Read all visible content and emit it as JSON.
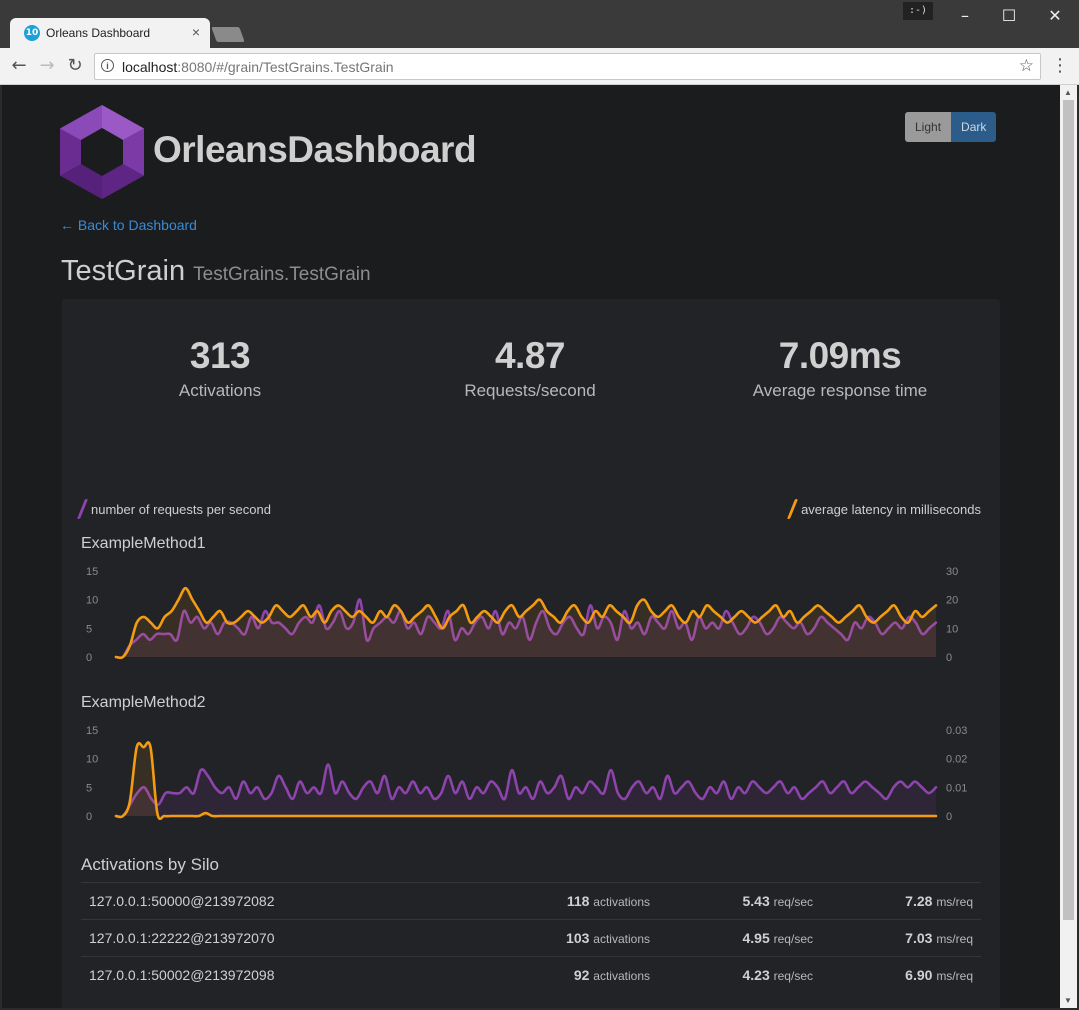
{
  "browser": {
    "tab_title": "Orleans Dashboard",
    "tab_icon": "10",
    "tab_close": "×",
    "badge": ":-)",
    "url_host": "localhost",
    "url_path": ":8080/#/grain/TestGrains.TestGrain"
  },
  "header": {
    "brand": "OrleansDashboard",
    "theme_light": "Light",
    "theme_dark": "Dark",
    "back_link": "← Back to Dashboard",
    "title": "TestGrain",
    "subtitle": "TestGrains.TestGrain"
  },
  "stats": [
    {
      "value": "313",
      "label": "Activations"
    },
    {
      "value": "4.87",
      "label": "Requests/second"
    },
    {
      "value": "7.09ms",
      "label": "Average response time"
    }
  ],
  "legend": {
    "left": "number of requests per second",
    "right": "average latency in milliseconds"
  },
  "colors": {
    "requests": "#8e44ad",
    "latency": "#f39c12",
    "link": "#3b8ad4",
    "background": "#1b1c1e",
    "panel": "#222326"
  },
  "chart_data": [
    {
      "type": "line",
      "title": "ExampleMethod1",
      "left_ticks": [
        "15",
        "10",
        "5",
        "0"
      ],
      "right_ticks": [
        "30",
        "20",
        "10",
        "0"
      ],
      "left_ylim": [
        0,
        15
      ],
      "right_ylim": [
        0,
        30
      ],
      "series": [
        {
          "values": [
            0,
            0,
            2,
            3,
            4,
            3,
            4,
            4,
            4,
            3,
            8,
            6,
            7,
            5,
            6,
            4,
            6,
            6,
            5,
            4,
            7,
            5,
            8,
            6,
            6,
            5,
            4,
            6,
            7,
            6,
            9,
            5,
            6,
            8,
            5,
            6,
            10,
            3,
            5,
            6,
            7,
            6,
            8,
            5,
            6,
            4,
            7,
            6,
            5,
            8,
            3,
            5,
            4,
            6,
            7,
            5,
            8,
            4,
            6,
            5,
            7,
            3,
            6,
            8,
            5,
            4,
            6,
            7,
            5,
            4,
            9,
            5,
            7,
            6,
            3,
            8,
            5,
            6,
            4,
            7,
            6,
            5,
            8,
            5,
            6,
            3,
            7,
            5,
            6,
            5,
            8,
            6,
            4,
            5,
            7,
            6,
            4,
            5,
            7,
            6,
            5,
            6,
            4,
            5,
            7,
            6,
            5,
            4,
            3,
            6,
            5,
            7,
            6,
            4,
            5,
            6,
            5,
            7,
            6,
            4,
            5,
            6
          ]
        },
        {
          "values": [
            0,
            0,
            4,
            12,
            14,
            12,
            10,
            14,
            16,
            20,
            24,
            20,
            16,
            12,
            14,
            16,
            12,
            12,
            14,
            16,
            14,
            12,
            14,
            18,
            16,
            14,
            16,
            18,
            14,
            16,
            12,
            16,
            18,
            16,
            14,
            16,
            14,
            12,
            16,
            14,
            18,
            16,
            12,
            14,
            16,
            18,
            14,
            10,
            14,
            16,
            18,
            12,
            14,
            16,
            14,
            12,
            16,
            18,
            14,
            16,
            18,
            20,
            16,
            14,
            12,
            16,
            18,
            14,
            12,
            16,
            14,
            18,
            16,
            14,
            12,
            18,
            20,
            16,
            14,
            16,
            18,
            14,
            12,
            16,
            14,
            18,
            16,
            14,
            12,
            14,
            16,
            14,
            12,
            14,
            16,
            18,
            14,
            16,
            12,
            14,
            16,
            18,
            16,
            14,
            12,
            14,
            16,
            18,
            14,
            12,
            14,
            16,
            18,
            14,
            12,
            16,
            14,
            16,
            18
          ]
        }
      ]
    },
    {
      "type": "line",
      "title": "ExampleMethod2",
      "left_ticks": [
        "15",
        "10",
        "5",
        "0"
      ],
      "right_ticks": [
        "0.03",
        "0.02",
        "0.01",
        "0"
      ],
      "left_ylim": [
        0,
        15
      ],
      "right_ylim": [
        0,
        0.03
      ],
      "series": [
        {
          "values": [
            0,
            0,
            2,
            4,
            5,
            3,
            2,
            4,
            4,
            4,
            5,
            4,
            8,
            7,
            5,
            4,
            5,
            3,
            6,
            4,
            5,
            3,
            4,
            7,
            5,
            3,
            6,
            4,
            5,
            4,
            9,
            4,
            6,
            4,
            3,
            5,
            6,
            4,
            7,
            3,
            5,
            4,
            6,
            4,
            5,
            3,
            4,
            7,
            4,
            6,
            3,
            5,
            4,
            6,
            5,
            3,
            8,
            4,
            5,
            3,
            6,
            4,
            5,
            7,
            3,
            5,
            4,
            6,
            5,
            4,
            8,
            4,
            3,
            5,
            6,
            4,
            5,
            3,
            7,
            4,
            5,
            6,
            4,
            3,
            5,
            4,
            6,
            3,
            5,
            4,
            6,
            5,
            4,
            5,
            6,
            4,
            5,
            3,
            4,
            5,
            6,
            4,
            5,
            6,
            4,
            5,
            6,
            5,
            4,
            3,
            5,
            6,
            5,
            6,
            5,
            4,
            5
          ]
        },
        {
          "values": [
            0,
            0,
            0.005,
            0.024,
            0.024,
            0.024,
            0.001,
            0,
            0,
            0,
            0,
            0,
            0,
            0.001,
            0,
            0,
            0,
            0,
            0,
            0,
            0,
            0,
            0,
            0,
            0,
            0,
            0,
            0,
            0,
            0,
            0,
            0,
            0,
            0,
            0,
            0,
            0,
            0,
            0,
            0,
            0,
            0,
            0,
            0,
            0,
            0,
            0,
            0,
            0,
            0,
            0,
            0,
            0,
            0,
            0,
            0,
            0,
            0,
            0,
            0,
            0,
            0,
            0,
            0,
            0,
            0,
            0,
            0,
            0,
            0,
            0,
            0,
            0,
            0,
            0,
            0,
            0,
            0,
            0,
            0,
            0,
            0,
            0,
            0,
            0,
            0,
            0,
            0,
            0,
            0,
            0,
            0,
            0,
            0,
            0,
            0,
            0,
            0,
            0,
            0,
            0,
            0,
            0,
            0,
            0,
            0,
            0,
            0,
            0,
            0,
            0,
            0,
            0,
            0,
            0,
            0,
            0,
            0,
            0,
            0
          ]
        }
      ]
    }
  ],
  "silos": {
    "title": "Activations by Silo",
    "rows": [
      {
        "address": "127.0.0.1:50000@213972082",
        "activations": "118",
        "act_unit": "activations",
        "req": "5.43",
        "req_unit": "req/sec",
        "ms": "7.28",
        "ms_unit": "ms/req"
      },
      {
        "address": "127.0.0.1:22222@213972070",
        "activations": "103",
        "act_unit": "activations",
        "req": "4.95",
        "req_unit": "req/sec",
        "ms": "7.03",
        "ms_unit": "ms/req"
      },
      {
        "address": "127.0.0.1:50002@213972098",
        "activations": "92",
        "act_unit": "activations",
        "req": "4.23",
        "req_unit": "req/sec",
        "ms": "6.90",
        "ms_unit": "ms/req"
      }
    ]
  }
}
